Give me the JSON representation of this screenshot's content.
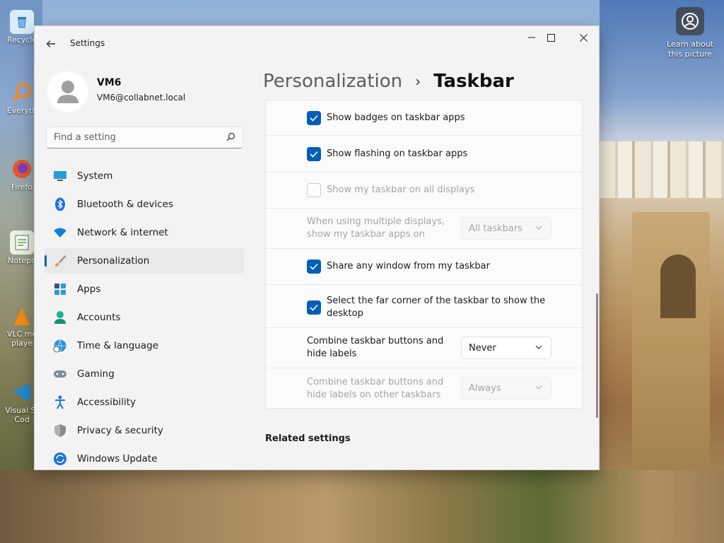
{
  "desktop": {
    "icons": [
      {
        "label": "Recycle",
        "icon": "recycle-bin-icon",
        "color": "#7fb6e8"
      },
      {
        "label": "Everyth",
        "icon": "everything-search-icon",
        "color": "#f08a24"
      },
      {
        "label": "Firefo",
        "icon": "firefox-icon",
        "color": "#e8542a"
      },
      {
        "label": "Notepa",
        "icon": "notepad-icon",
        "color": "#7cc46a"
      },
      {
        "label": "VLC me playe",
        "icon": "vlc-icon",
        "color": "#f28c13"
      },
      {
        "label": "Visual St Cod",
        "icon": "vscode-icon",
        "color": "#1f8ad2"
      }
    ],
    "learn_picture": "Learn about this picture"
  },
  "window": {
    "app_title": "Settings",
    "controls": [
      "minimize",
      "maximize",
      "close"
    ]
  },
  "profile": {
    "name": "VM6",
    "email": "VM6@collabnet.local"
  },
  "search": {
    "placeholder": "Find a setting"
  },
  "nav": {
    "items": [
      {
        "label": "System",
        "icon": "system-icon",
        "active": false
      },
      {
        "label": "Bluetooth & devices",
        "icon": "bluetooth-icon",
        "active": false
      },
      {
        "label": "Network & internet",
        "icon": "network-icon",
        "active": false
      },
      {
        "label": "Personalization",
        "icon": "brush-icon",
        "active": true
      },
      {
        "label": "Apps",
        "icon": "apps-icon",
        "active": false
      },
      {
        "label": "Accounts",
        "icon": "accounts-icon",
        "active": false
      },
      {
        "label": "Time & language",
        "icon": "globe-clock-icon",
        "active": false
      },
      {
        "label": "Gaming",
        "icon": "gamepad-icon",
        "active": false
      },
      {
        "label": "Accessibility",
        "icon": "accessibility-icon",
        "active": false
      },
      {
        "label": "Privacy & security",
        "icon": "shield-icon",
        "active": false
      },
      {
        "label": "Windows Update",
        "icon": "update-icon",
        "active": false
      }
    ]
  },
  "breadcrumb": {
    "parent": "Personalization",
    "separator": "›",
    "current": "Taskbar"
  },
  "settings": {
    "show_badges": {
      "label": "Show badges on taskbar apps",
      "checked": true,
      "enabled": true
    },
    "show_flashing": {
      "label": "Show flashing on taskbar apps",
      "checked": true,
      "enabled": true
    },
    "all_displays": {
      "label": "Show my taskbar on all displays",
      "checked": false,
      "enabled": false
    },
    "multiple_displays": {
      "label_line1": "When using multiple displays,",
      "label_line2": "show my taskbar apps on",
      "value": "All taskbars",
      "enabled": false
    },
    "share_window": {
      "label": "Share any window from my taskbar",
      "checked": true,
      "enabled": true
    },
    "far_corner": {
      "label_line1": "Select the far corner of the taskbar to show the",
      "label_line2": "desktop",
      "checked": true,
      "enabled": true
    },
    "combine": {
      "label_line1": "Combine taskbar buttons and",
      "label_line2": "hide labels",
      "value": "Never",
      "enabled": true
    },
    "combine_other": {
      "label_line1": "Combine taskbar buttons and",
      "label_line2": "hide labels on other taskbars",
      "value": "Always",
      "enabled": false
    }
  },
  "related": {
    "heading": "Related settings"
  },
  "colors": {
    "accent": "#005fb8",
    "window_bg": "#f3f3f3",
    "card_bg": "#fbfbfb"
  }
}
